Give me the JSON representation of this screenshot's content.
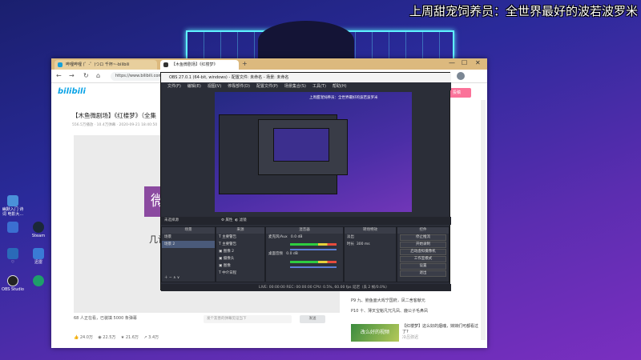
{
  "overlay": {
    "caption": "上周甜宠饲养员：全世界最好的波若波罗米"
  },
  "desktop": {
    "icons": [
      {
        "label": "幽默入门 诗词 电影大...",
        "icon": "doc-icon",
        "color": "#4a90d9"
      },
      {
        "label": "Steam",
        "icon": "steam-icon",
        "color": "#1b2838"
      },
      {
        "label": "",
        "icon": "gear-icon",
        "color": "#3b6fd1"
      },
      {
        "label": "♡",
        "icon": "plane-icon",
        "color": "#2a6ab8"
      },
      {
        "label": "迅雷",
        "icon": "thunder-icon",
        "color": "#3a7bd5"
      },
      {
        "label": "OBS Studio",
        "icon": "obs-icon",
        "color": "#222"
      },
      {
        "label": "",
        "icon": "edge-icon",
        "color": "#1e9e6a"
      }
    ]
  },
  "browser": {
    "tabs": [
      {
        "label": "哔哩哔哩 (゜-゜)つロ 千杯~-bilibili"
      },
      {
        "label": "【木鱼微剧场】《红楼梦》"
      }
    ],
    "new_tab": "+",
    "win_controls": {
      "min": "—",
      "max": "☐",
      "close": "✕"
    },
    "nav": {
      "back": "←",
      "forward": "→",
      "reload": "↻",
      "home": "⌂"
    },
    "url": "https://www.bilibili.com/video/...",
    "site": {
      "logo": "bilibili",
      "upload": "投稿"
    },
    "video": {
      "title": "【木鱼微剧场】《红楼梦》（全集",
      "meta": "556.5万播放 · 10.4万弹幕 · 2020-09-21 18:40:50",
      "logo_char": "微",
      "overlay_text": "几许",
      "danmaku_count": "68 人正在看，已装填 5000 条弹幕",
      "danmaku_placeholder": "发个友善的弹幕见证当下",
      "danmaku_etiquette": "弹幕礼仪 >",
      "send": "发送",
      "stats": [
        "24.0万",
        "22.5万",
        "21.6万",
        "3.4万"
      ]
    },
    "sidebar": {
      "episodes": [
        {
          "label": "P9 九、鲍鱼面大戏宁国府，凤二舍客献元"
        },
        {
          "label": "P10 十、薄叉宝魁凡冗凡凤、鹿公子毛鼻凤"
        }
      ],
      "rec_thumb_text": "改么好的视频",
      "rec_title": "【红楼梦】这么好的烟魂，妹妹们可都看过了?",
      "rec_meta": "冷吕弥迟"
    }
  },
  "obs": {
    "title": "OBS 27.0.1 (64-bit, windows) - 配置文件: 未命名 - 场景: 未命名",
    "menu": [
      "文件(F)",
      "编辑(E)",
      "视图(V)",
      "停靠部件(D)",
      "配置文件(P)",
      "场景集合(S)",
      "工具(T)",
      "帮助(H)"
    ],
    "preview_caption": "上周甜宠饲养员：全世界最好的波若波罗米",
    "no_source": "未选择源",
    "props": "属性",
    "filters": "滤镜",
    "docks": {
      "scenes": {
        "title": "场景",
        "items": [
          "场景",
          "场景 2"
        ]
      },
      "sources": {
        "title": "来源",
        "items": [
          "主要警告",
          "主要警告",
          "图像 2",
          "摄像头",
          "图像",
          "中介日程"
        ]
      },
      "mixer": {
        "title": "混音器",
        "channels": [
          {
            "name": "麦克风/Aux",
            "db": "0.0 dB"
          },
          {
            "name": "桌面音频",
            "db": "0.0 dB"
          }
        ]
      },
      "transitions": {
        "title": "转场特效",
        "type": "淡出",
        "duration_label": "时长",
        "duration": "300 ms"
      },
      "controls": {
        "title": "控件",
        "buttons": [
          "停止推流",
          "开始录制",
          "启动虚拟摄像机",
          "工作室模式",
          "设置",
          "退出"
        ]
      }
    },
    "status": "LIVE: 00:00:00   REC: 00:00:00   CPU: 0.5%, 60.00 fps   延迟（丢 2 帧/0.0%）"
  }
}
